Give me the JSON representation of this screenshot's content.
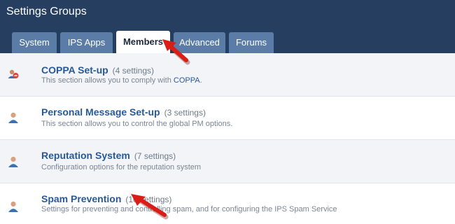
{
  "header": {
    "title": "Settings Groups"
  },
  "tabs": [
    {
      "label": "System"
    },
    {
      "label": "IPS Apps"
    },
    {
      "label": "Members",
      "active": true
    },
    {
      "label": "Advanced"
    },
    {
      "label": "Forums"
    }
  ],
  "groups": [
    {
      "title": "COPPA Set-up",
      "count": "(4 settings)",
      "desc": "This section allows you to comply with ",
      "desc_link": "COPPA",
      "desc_end": ".",
      "icon": "coppa-group-icon"
    },
    {
      "title": "Personal Message Set-up",
      "count": "(3 settings)",
      "desc": "This section allows you to control the global PM options.",
      "icon": "member-icon"
    },
    {
      "title": "Reputation System",
      "count": "(7 settings)",
      "desc": "Configuration options for the reputation system",
      "icon": "member-icon"
    },
    {
      "title": "Spam Prevention",
      "count": "(10 settings)",
      "desc": "Settings for preventing and controlling spam, and for configuring the IPS Spam Service",
      "icon": "member-icon"
    }
  ],
  "colors": {
    "header_bg": "#263f61",
    "tab_bg": "#5b7ca6",
    "link": "#27599a",
    "arrow": "#d91e18"
  }
}
